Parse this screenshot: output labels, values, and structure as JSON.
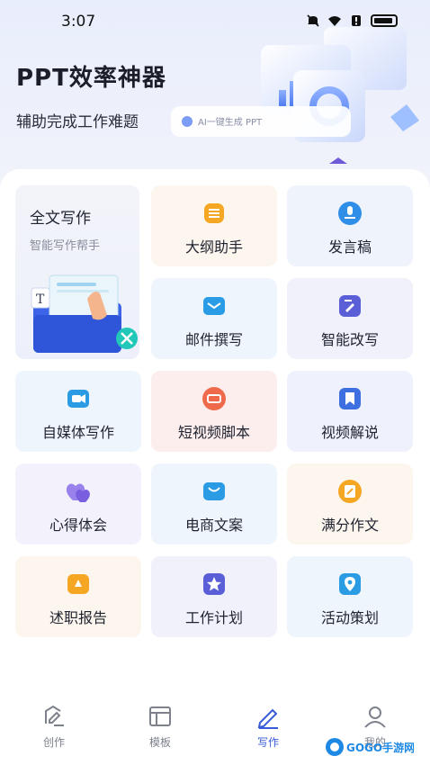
{
  "status": {
    "time": "3:07"
  },
  "hero": {
    "title": "PPT效率神器",
    "subtitle": "辅助完成工作难题",
    "art_caption": "AI一键生成 PPT"
  },
  "featured": {
    "title": "全文写作",
    "subtitle": "智能写作帮手",
    "icon": "document-folder-illustration"
  },
  "tools": [
    {
      "label": "大纲助手",
      "icon": "outline-icon",
      "color": "#f5a623",
      "bg": "#fdf6ee"
    },
    {
      "label": "发言稿",
      "icon": "speech-icon",
      "color": "#2e8ee8",
      "bg": "#eef3fc"
    },
    {
      "label": "邮件撰写",
      "icon": "mail-icon",
      "color": "#2a9ce6",
      "bg": "#eff5fc"
    },
    {
      "label": "智能改写",
      "icon": "rewrite-icon",
      "color": "#5a5fd8",
      "bg": "#f1f1fb"
    },
    {
      "label": "自媒体写作",
      "icon": "camera-icon",
      "color": "#2b9be3",
      "bg": "#eff5fc"
    },
    {
      "label": "短视频脚本",
      "icon": "video-script-icon",
      "color": "#ef6a4a",
      "bg": "#fdeeee"
    },
    {
      "label": "视频解说",
      "icon": "bookmark-icon",
      "color": "#3d6fe0",
      "bg": "#eff2fc"
    },
    {
      "label": "心得体会",
      "icon": "hearts-icon",
      "color": "#7a5ee0",
      "bg": "#f3f1fb"
    },
    {
      "label": "电商文案",
      "icon": "shop-icon",
      "color": "#2b9be3",
      "bg": "#eff5fc"
    },
    {
      "label": "满分作文",
      "icon": "essay-icon",
      "color": "#f5a623",
      "bg": "#fdf6ee"
    },
    {
      "label": "述职报告",
      "icon": "report-icon",
      "color": "#f5a623",
      "bg": "#fdf6ee"
    },
    {
      "label": "工作计划",
      "icon": "star-plan-icon",
      "color": "#5a5fd8",
      "bg": "#f1f1fb"
    },
    {
      "label": "活动策划",
      "icon": "location-icon",
      "color": "#2b9be3",
      "bg": "#eff5fc"
    }
  ],
  "tabbar": [
    {
      "label": "创作",
      "icon": "create-icon",
      "active": false
    },
    {
      "label": "模板",
      "icon": "template-icon",
      "active": false
    },
    {
      "label": "写作",
      "icon": "pen-icon",
      "active": true
    },
    {
      "label": "我的",
      "icon": "profile-icon",
      "active": false
    }
  ],
  "watermark": "GOGO手游网",
  "colors": {
    "accent": "#3a5bd9",
    "inactive": "#7d818c"
  }
}
